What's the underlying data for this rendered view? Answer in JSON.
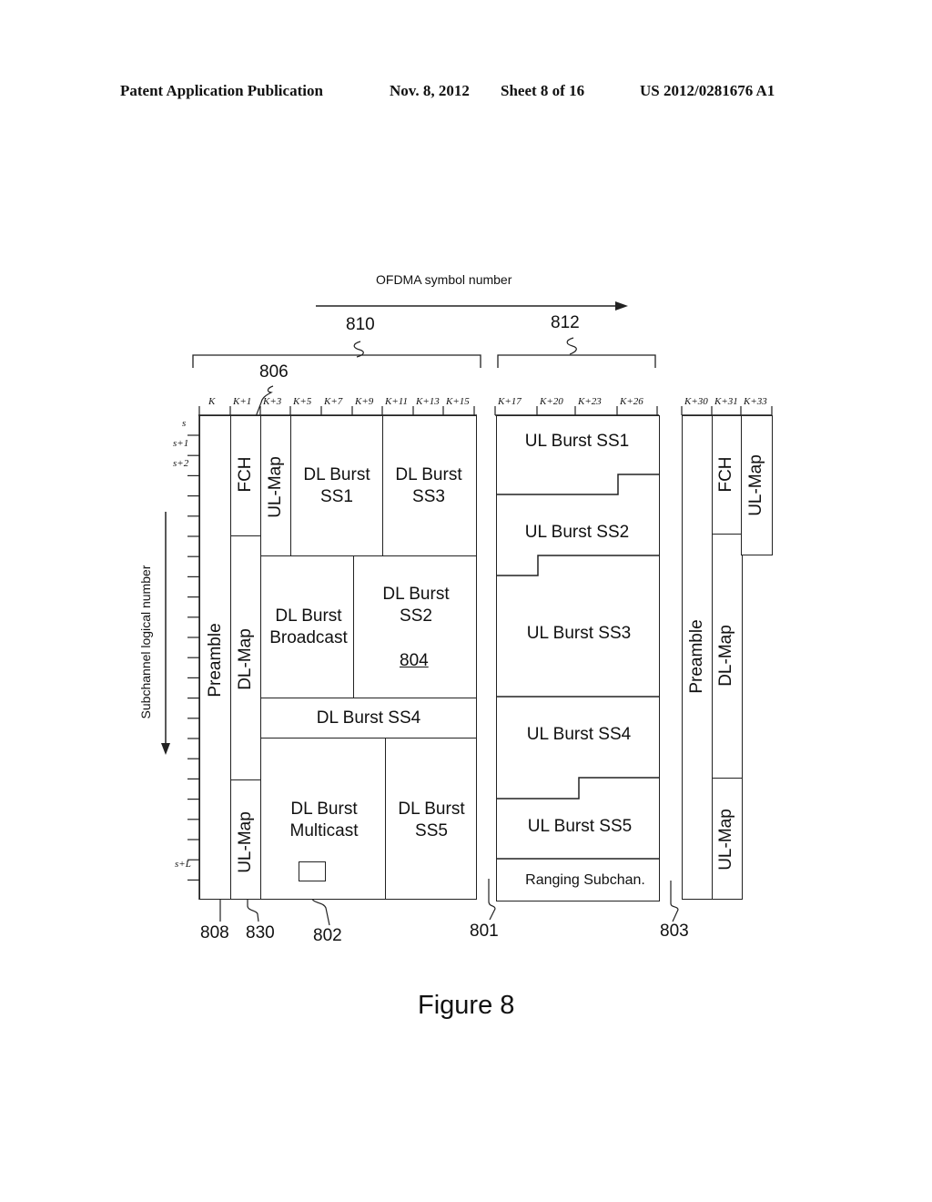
{
  "header": {
    "publication": "Patent Application Publication",
    "date": "Nov. 8, 2012",
    "sheet": "Sheet 8 of 16",
    "number": "US 2012/0281676 A1"
  },
  "axes": {
    "x_label": "OFDMA symbol number",
    "y_label": "Subchannel logical number"
  },
  "refs": {
    "r810": "810",
    "r812": "812",
    "r806": "806",
    "r808": "808",
    "r830": "830",
    "r802": "802",
    "r801": "801",
    "r803": "803",
    "r804": "804"
  },
  "symbol_ticks": {
    "frame1": [
      "K",
      "K+1",
      "K+3",
      "K+5",
      "K+7",
      "K+9",
      "K+11",
      "K+13",
      "K+15"
    ],
    "frame2": [
      "K+17",
      "K+20",
      "K+23",
      "K+26"
    ],
    "frame3": [
      "K+30",
      "K+31",
      "K+33"
    ]
  },
  "subchannel_ticks": [
    "s",
    "s+1",
    "s+2",
    "s+L"
  ],
  "downlink": {
    "preamble": "Preamble",
    "fch": "FCH",
    "dl_map": "DL-Map",
    "ul_map_top": "UL-Map",
    "ul_map_bottom": "UL-Map",
    "burst_ss1": [
      "DL Burst",
      "SS1"
    ],
    "burst_ss3": [
      "DL Burst",
      "SS3"
    ],
    "burst_broadcast": [
      "DL Burst",
      "Broadcast"
    ],
    "burst_ss2": [
      "DL Burst",
      "SS2"
    ],
    "burst_ss4": "DL Burst SS4",
    "burst_multicast": [
      "DL Burst",
      "Multicast"
    ],
    "burst_ss5": [
      "DL Burst",
      "SS5"
    ]
  },
  "uplink": {
    "ss1": "UL Burst SS1",
    "ss2": "UL Burst SS2",
    "ss3": "UL Burst SS3",
    "ss4": "UL Burst SS4",
    "ss5": "UL Burst SS5",
    "ranging": "Ranging Subchan."
  },
  "next_frame": {
    "preamble": "Preamble",
    "fch": "FCH",
    "dl_map": "DL-Map",
    "ul_map_top": "UL-Map",
    "ul_map_bottom": "UL-Map"
  },
  "caption": "Figure 8"
}
